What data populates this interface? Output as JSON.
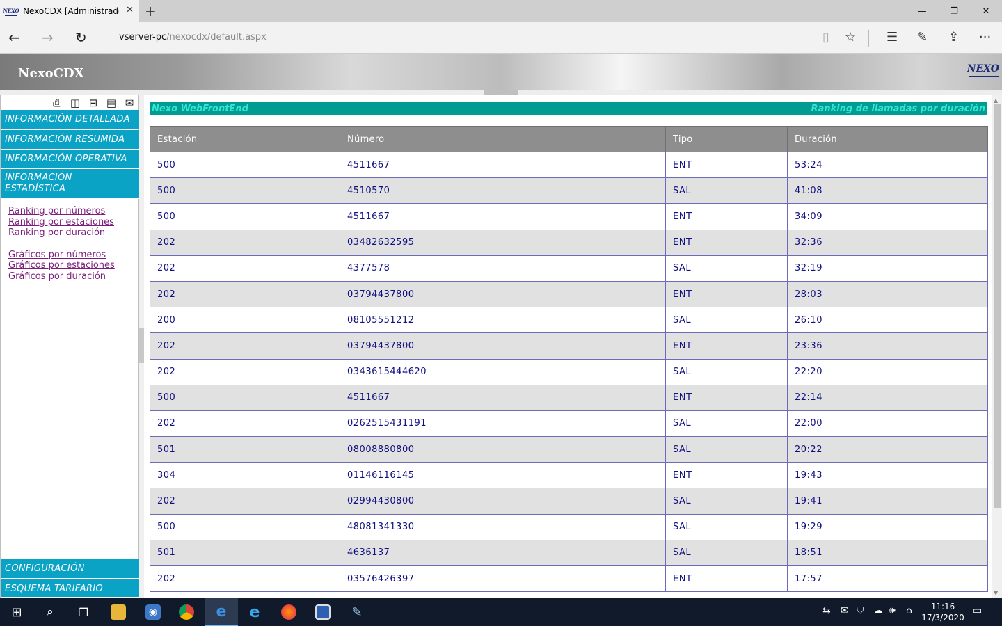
{
  "browser": {
    "tab_title": "NexoCDX [Administrador]",
    "tab_favicon": "NEXO",
    "url_host": "vserver-pc",
    "url_path": "/nexocdx/default.aspx"
  },
  "header": {
    "title": "NexoCDX",
    "logo": "NEXO"
  },
  "sidebar": {
    "menu": [
      "INFORMACIÓN DETALLADA",
      "INFORMACIÓN RESUMIDA",
      "INFORMACIÓN OPERATIVA",
      "INFORMACIÓN ESTADÍSTICA"
    ],
    "links_ranking": [
      "Ranking por números",
      "Ranking por estaciones",
      "Ranking por duración"
    ],
    "links_graficos": [
      "Gráficos por números",
      "Gráficos por estaciones",
      "Gráficos por duración"
    ],
    "bottom_menu": [
      "CONFIGURACIÓN",
      "ESQUEMA TARIFARIO"
    ]
  },
  "banner": {
    "left": "Nexo WebFrontEnd",
    "right": "Ranking de llamadas por duración"
  },
  "table": {
    "headers": [
      "Estación",
      "Número",
      "Tipo",
      "Duración"
    ],
    "rows": [
      [
        "500",
        "4511667",
        "ENT",
        "53:24"
      ],
      [
        "500",
        "4510570",
        "SAL",
        "41:08"
      ],
      [
        "500",
        "4511667",
        "ENT",
        "34:09"
      ],
      [
        "202",
        "03482632595",
        "ENT",
        "32:36"
      ],
      [
        "202",
        "4377578",
        "SAL",
        "32:19"
      ],
      [
        "202",
        "03794437800",
        "ENT",
        "28:03"
      ],
      [
        "200",
        "08105551212",
        "SAL",
        "26:10"
      ],
      [
        "202",
        "03794437800",
        "ENT",
        "23:36"
      ],
      [
        "202",
        "0343615444620",
        "SAL",
        "22:20"
      ],
      [
        "500",
        "4511667",
        "ENT",
        "22:14"
      ],
      [
        "202",
        "0262515431191",
        "SAL",
        "22:00"
      ],
      [
        "501",
        "08008880800",
        "SAL",
        "20:22"
      ],
      [
        "304",
        "01146116145",
        "ENT",
        "19:43"
      ],
      [
        "202",
        "02994430800",
        "SAL",
        "19:41"
      ],
      [
        "500",
        "48081341330",
        "SAL",
        "19:29"
      ],
      [
        "501",
        "4636137",
        "SAL",
        "18:51"
      ],
      [
        "202",
        "03576426397",
        "ENT",
        "17:57"
      ]
    ]
  },
  "taskbar": {
    "time": "11:16",
    "date": "17/3/2020"
  }
}
